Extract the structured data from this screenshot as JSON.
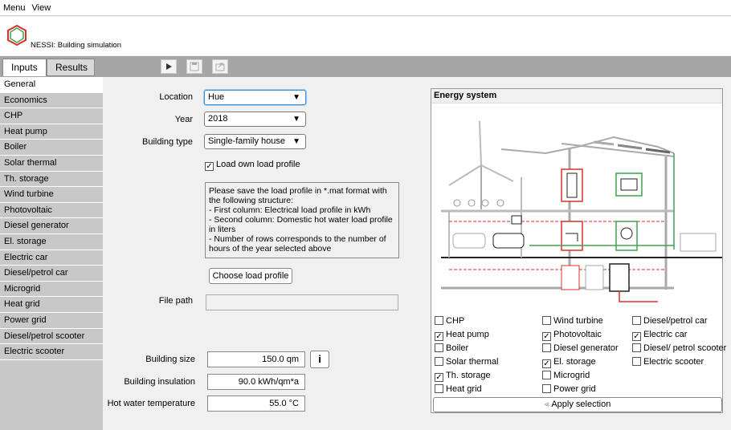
{
  "menu": {
    "items": [
      "Menu",
      "View"
    ]
  },
  "app": {
    "title": "NESSI: Building simulation"
  },
  "tabs": {
    "inputs": "Inputs",
    "results": "Results"
  },
  "sidebar": {
    "items": [
      "General",
      "Economics",
      "CHP",
      "Heat pump",
      "Boiler",
      "Solar thermal",
      "Th. storage",
      "Wind turbine",
      "Photovoltaic",
      "Diesel generator",
      "El. storage",
      "Electric car",
      "Diesel/petrol car",
      "Microgrid",
      "Heat grid",
      "Power grid",
      "Diesel/petrol scooter",
      "Electric scooter"
    ],
    "active": "General"
  },
  "form": {
    "location_label": "Location",
    "location_value": "Hue",
    "year_label": "Year",
    "year_value": "2018",
    "building_type_label": "Building type",
    "building_type_value": "Single-family house",
    "load_own_label": "Load own load profile",
    "load_own_checked": true,
    "info_text": "Please save the load profile in *.mat format with the following structure:\n- First column: Electrical load profile in kWh\n- Second column: Domestic hot water load profile in liters\n- Number of rows corresponds to the number of hours of the year selected above",
    "choose_button": "Choose load profile",
    "file_path_label": "File path",
    "file_path_value": "",
    "building_size_label": "Building size",
    "building_size_value": "150.0 qm",
    "info_button": "i",
    "insulation_label": "Building insulation",
    "insulation_value": "90.0 kWh/qm*a",
    "hot_water_label": "Hot water temperature",
    "hot_water_value": "55.0 °C"
  },
  "energy_system": {
    "title": "Energy system",
    "col1": [
      {
        "label": "CHP",
        "checked": false
      },
      {
        "label": "Heat pump",
        "checked": true
      },
      {
        "label": "Boiler",
        "checked": false
      },
      {
        "label": "Solar thermal",
        "checked": false
      },
      {
        "label": "Th. storage",
        "checked": true
      },
      {
        "label": "Heat grid",
        "checked": false
      }
    ],
    "col2": [
      {
        "label": "Wind turbine",
        "checked": false
      },
      {
        "label": "Photovoltaic",
        "checked": true
      },
      {
        "label": "Diesel generator",
        "checked": false
      },
      {
        "label": "El. storage",
        "checked": true
      },
      {
        "label": "Microgrid",
        "checked": false
      },
      {
        "label": "Power grid",
        "checked": false
      }
    ],
    "col3": [
      {
        "label": "Diesel/petrol car",
        "checked": false
      },
      {
        "label": "Electric car",
        "checked": true
      },
      {
        "label": "Diesel/ petrol scooter",
        "checked": false
      },
      {
        "label": "Electric scooter",
        "checked": false
      }
    ],
    "apply_button": "Apply selection"
  },
  "colors": {
    "accent_red": "#d9312b",
    "accent_green": "#3fa34d",
    "focus_blue": "#3c8fd6"
  }
}
